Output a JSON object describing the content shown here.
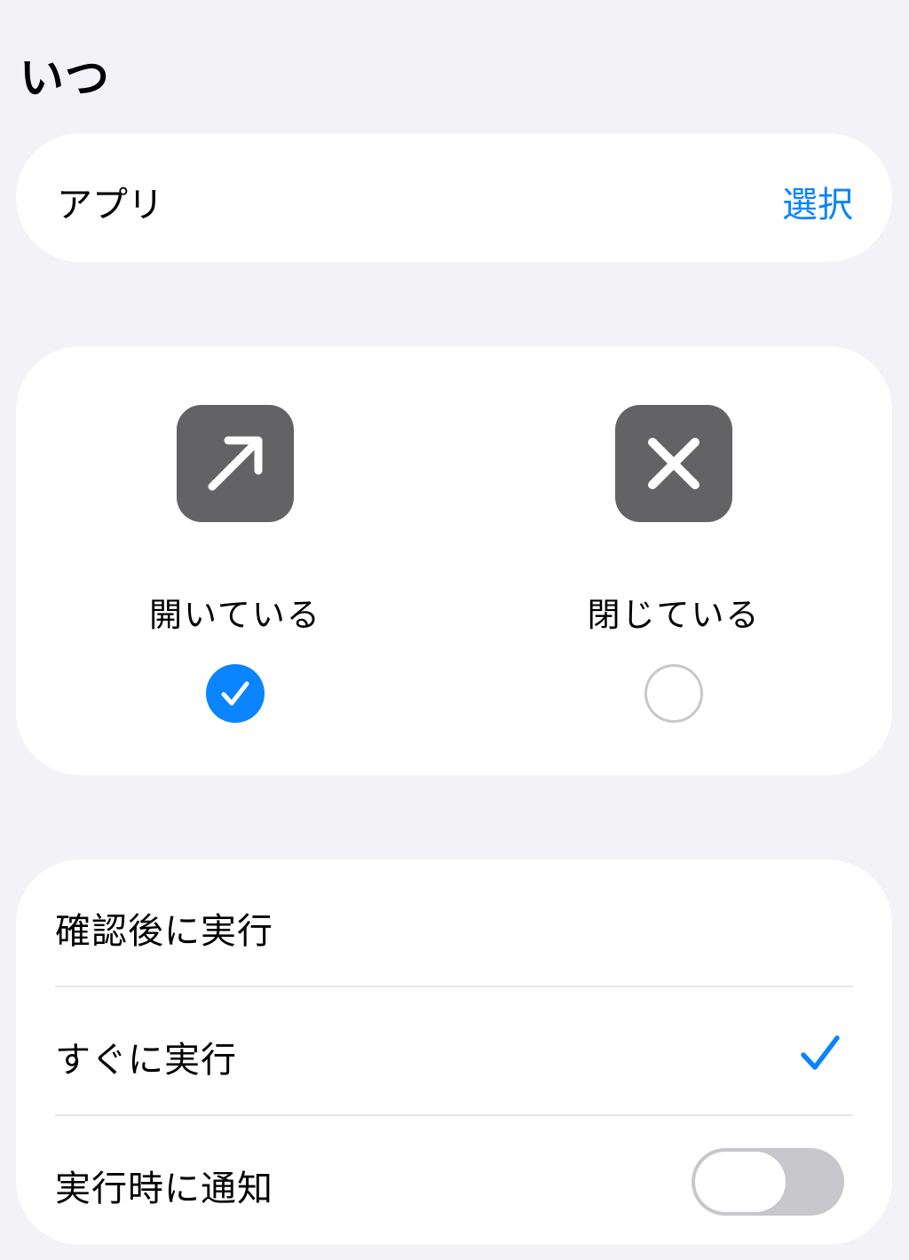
{
  "section_title": "いつ",
  "app_row": {
    "label": "アプリ",
    "action": "選択"
  },
  "state_options": [
    {
      "label": "開いている",
      "icon": "arrow-up-right-icon",
      "selected": true
    },
    {
      "label": "閉じている",
      "icon": "xmark-icon",
      "selected": false
    }
  ],
  "run_options": {
    "confirm_label": "確認後に実行",
    "immediate_label": "すぐに実行",
    "immediate_selected": true,
    "notify_label": "実行時に通知",
    "notify_on": false
  },
  "colors": {
    "accent": "#0a84ff",
    "icon_tile": "#636366",
    "background": "#f2f2f7",
    "toggle_off": "#c7c7cc"
  }
}
